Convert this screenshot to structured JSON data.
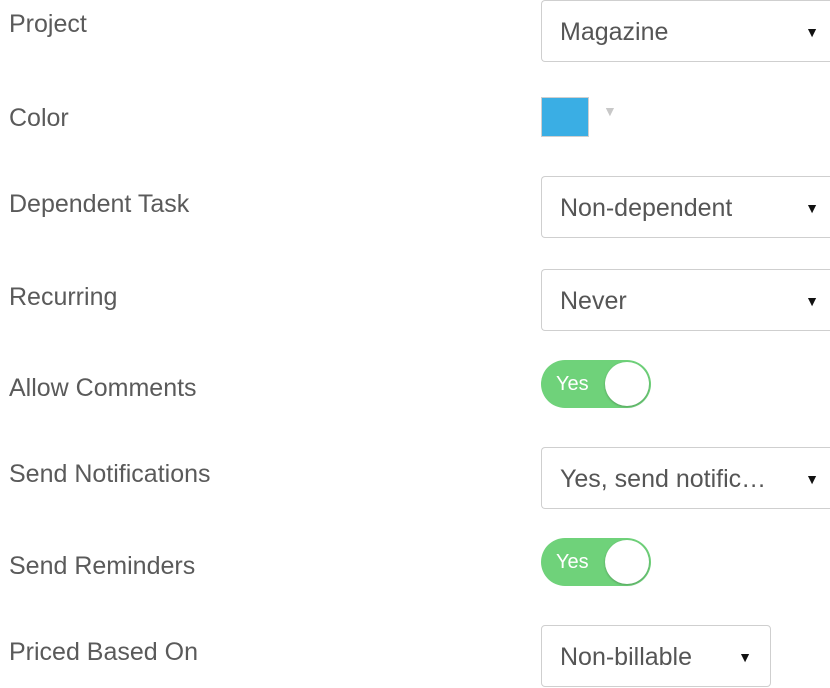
{
  "fields": {
    "project": {
      "label": "Project",
      "value": "Magazine",
      "arrow": "▼"
    },
    "color": {
      "label": "Color",
      "swatch_color": "#3aaee4",
      "arrow": "▼"
    },
    "dependent_task": {
      "label": "Dependent Task",
      "value": "Non-dependent",
      "arrow": "▼"
    },
    "recurring": {
      "label": "Recurring",
      "value": "Never",
      "arrow": "▼"
    },
    "allow_comments": {
      "label": "Allow Comments",
      "toggle_text": "Yes",
      "on": true
    },
    "send_notifications": {
      "label": "Send Notifications",
      "value": "Yes, send notific…",
      "arrow": "▼"
    },
    "send_reminders": {
      "label": "Send Reminders",
      "toggle_text": "Yes",
      "on": true
    },
    "priced_based_on": {
      "label": "Priced Based On",
      "value": "Non-billable",
      "arrow": "▼"
    }
  },
  "colors": {
    "toggle_on": "#6fd27a",
    "swatch": "#3aaee4",
    "label_text": "#5a5a5a"
  }
}
